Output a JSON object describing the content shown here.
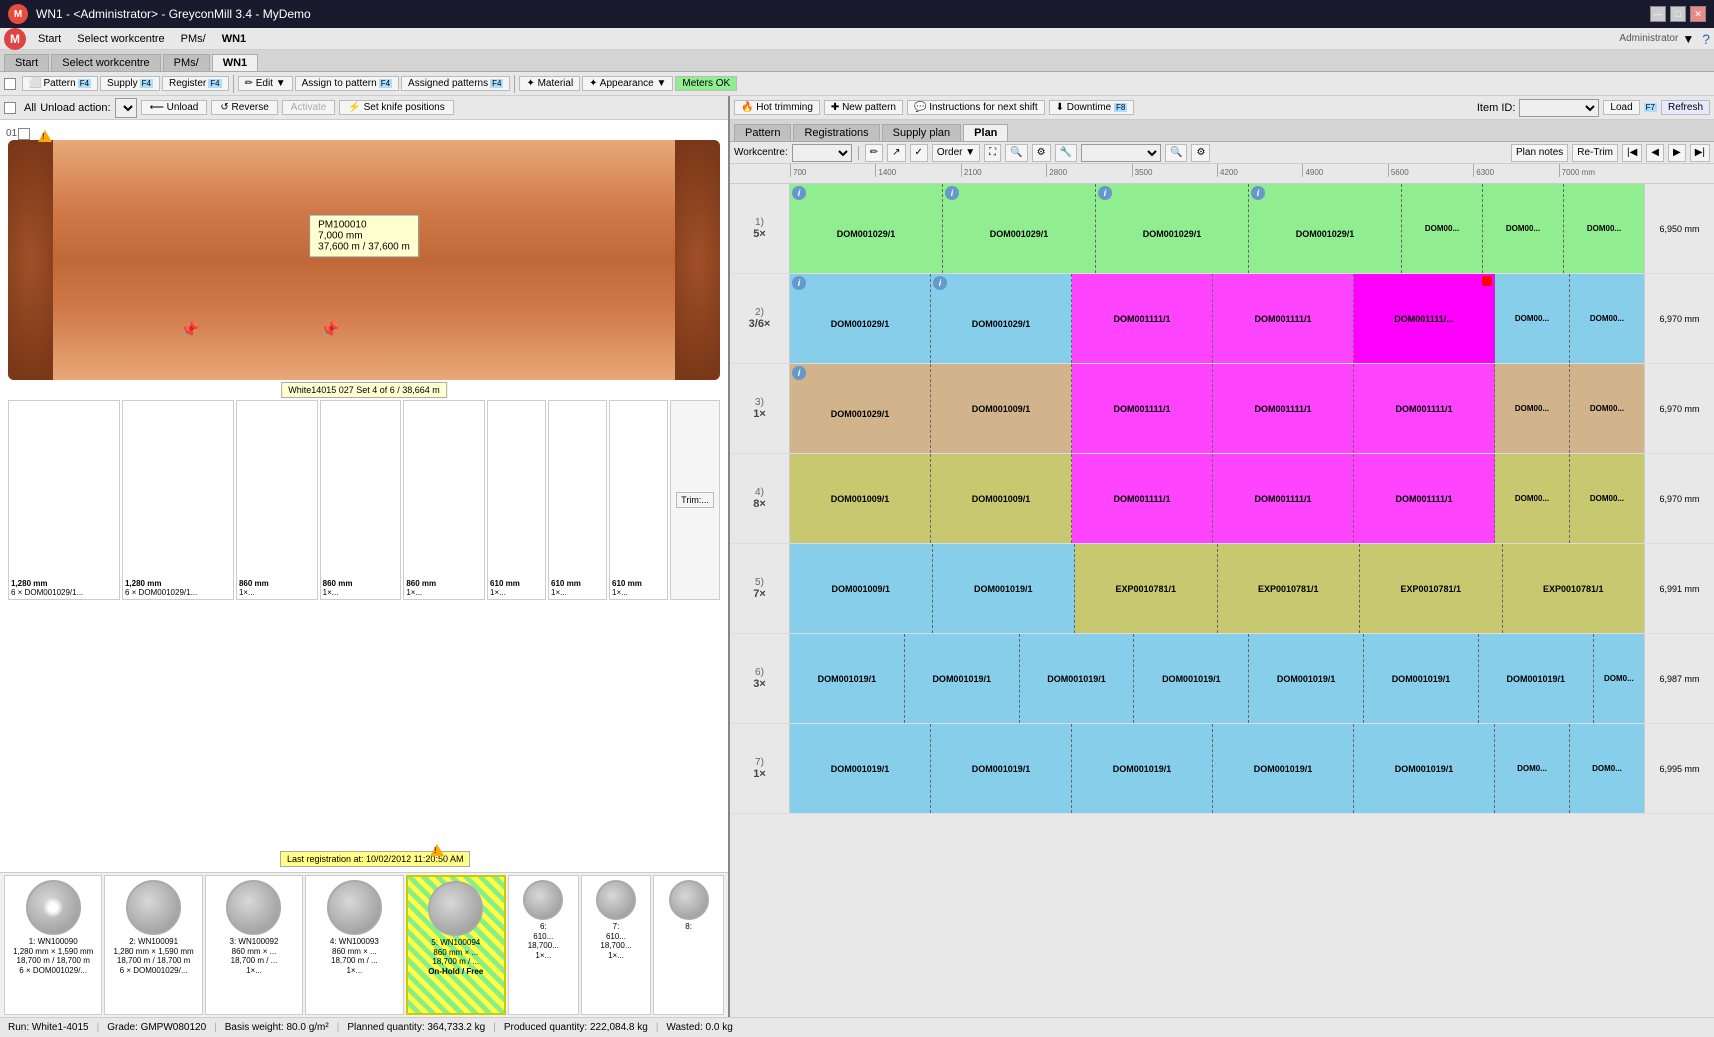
{
  "titlebar": {
    "title": "WN1 - <Administrator> - GreyconMill 3.4 - MyDemo",
    "min": "—",
    "max": "□",
    "close": "✕",
    "user": "Administrator"
  },
  "menubar": {
    "items": [
      "Start",
      "Select workcentre",
      "PMs/",
      "WN1"
    ]
  },
  "toolbar": {
    "items": [
      "⬜ Pattern",
      "Supply",
      "Register",
      "Edit ▼",
      "Assign to pattern",
      "Assigned patterns",
      "Material",
      "Appearance ▼",
      "Meters OK"
    ]
  },
  "unload": {
    "label": "All",
    "action_label": "Unload action:",
    "unload_btn": "⟵ Unload",
    "reverse_btn": "↺ Reverse",
    "activate_btn": "Activate",
    "set_knife_btn": "⚡ Set knife positions"
  },
  "roll": {
    "id": "PM100010",
    "length": "7,000 mm",
    "progress": "37,600 m / 37,600 m",
    "set_label": "White14015 027 Set 4 of 6 / 38,664 m"
  },
  "cuts": [
    {
      "width": "1,280 mm",
      "desc": "6 × DOM001029/1..."
    },
    {
      "width": "1,280 mm",
      "desc": "6 × DOM001029/1..."
    },
    {
      "width": "860 mm",
      "desc": "1×..."
    },
    {
      "width": "860 mm",
      "desc": "1×..."
    },
    {
      "width": "860 mm",
      "desc": "1×..."
    },
    {
      "width": "610 mm",
      "desc": "1×..."
    },
    {
      "width": "610 mm",
      "desc": "1×..."
    },
    {
      "width": "610 mm",
      "desc": "1×..."
    }
  ],
  "trim_btn": "Trim:...",
  "reels": [
    {
      "id": "1: WN100090",
      "spec": "1,280 mm × 1,590 mm",
      "meters": "18,700 m / 18,700 m",
      "desc": "6 × DOM001029/..."
    },
    {
      "id": "2: WN100091",
      "spec": "1,280 mm × 1,590 mm",
      "meters": "18,700 m / 18,700 m",
      "desc": "6 × DOM001029/..."
    },
    {
      "id": "3: WN100092",
      "spec": "860 mm × ...",
      "meters": "18,700 m / ...",
      "desc": "1×..."
    },
    {
      "id": "4: WN100093",
      "spec": "860 mm × ...",
      "meters": "18,700 m / ...",
      "desc": "1×..."
    },
    {
      "id": "5: WN100094",
      "spec": "860 mm × ...",
      "meters": "18,700 m / ...",
      "desc": "On-Hold / Free",
      "highlighted": true
    },
    {
      "id": "6:",
      "spec": "610...",
      "meters": "18,700...",
      "desc": "1×..."
    },
    {
      "id": "7:",
      "spec": "610...",
      "meters": "18,700...",
      "desc": "1×..."
    },
    {
      "id": "8:",
      "spec": "",
      "meters": "",
      "desc": ""
    }
  ],
  "right_toolbar": {
    "items": [
      "🔥 Hot trimming",
      "✚ New pattern",
      "💬 Instructions for next shift",
      "⬇ Downtime"
    ],
    "item_id_label": "Item ID:",
    "load_btn": "Load",
    "refresh_btn": "Refresh"
  },
  "right_tabs": [
    "Pattern",
    "Registrations",
    "Supply plan",
    "Plan"
  ],
  "active_right_tab": "Plan",
  "plan_controls": {
    "workcentre_label": "Workcentre:",
    "order_label": "Order ▼",
    "plan_notes_btn": "Plan notes",
    "retrim_btn": "Re-Trim"
  },
  "ruler": {
    "ticks": [
      "700",
      "1400",
      "2100",
      "2800",
      "3500",
      "4200",
      "4900",
      "5600",
      "6300",
      "7000 mm"
    ]
  },
  "plan_rows": [
    {
      "num": "1)",
      "mult": "5×",
      "cells": [
        "DOM001029/1",
        "DOM001029/1",
        "DOM001029/1",
        "DOM001029/1",
        "DOM00...",
        "DOM00...",
        "DOM00..."
      ],
      "color": "row-green",
      "right_label": "6,950 mm"
    },
    {
      "num": "2)",
      "mult": "3/6×",
      "cells": [
        "DOM001029/1",
        "DOM001029/1",
        "DOM001111/1",
        "DOM001111/1",
        "DOM001111/...",
        "DOM00...",
        "DOM00..."
      ],
      "color": "row-cyan",
      "right_label": "6,970 mm",
      "has_magenta": true
    },
    {
      "num": "3)",
      "mult": "1×",
      "cells": [
        "DOM001029/1",
        "DOM001009/1",
        "DOM001111/1",
        "DOM001111/1",
        "DOM001111/1",
        "DOM00...",
        "DOM00..."
      ],
      "color": "row-tan",
      "right_label": "6,970 mm",
      "has_magenta": true
    },
    {
      "num": "4)",
      "mult": "8×",
      "cells": [
        "DOM001009/1",
        "DOM001009/1",
        "DOM001111/1",
        "DOM001111/1",
        "DOM001111/1",
        "DOM00...",
        "DOM00..."
      ],
      "color": "row-olive",
      "right_label": "6,970 mm",
      "has_magenta": true
    },
    {
      "num": "5)",
      "mult": "7×",
      "cells": [
        "DOM001009/1",
        "DOM001019/1",
        "EXP0010781/1",
        "EXP0010781/1",
        "EXP0010781/1",
        "EXP0010781/1"
      ],
      "color": "row-blue-light",
      "right_label": "6,991 mm"
    },
    {
      "num": "6)",
      "mult": "3×",
      "cells": [
        "DOM001019/1",
        "DOM001019/1",
        "DOM001019/1",
        "DOM001019/1",
        "DOM001019/1",
        "DOM001019/1",
        "DOM001019/1",
        "DOM0..."
      ],
      "color": "row-cyan",
      "right_label": "6,987 mm"
    },
    {
      "num": "7)",
      "mult": "1×",
      "cells": [
        "DOM001019/1",
        "DOM001019/1",
        "DOM001019/1",
        "DOM001019/1",
        "DOM001019/1",
        "DOM0...",
        "DOM0..."
      ],
      "color": "row-cyan",
      "right_label": "6,995 mm"
    }
  ],
  "statusbar": {
    "run": "Run:  White1-4015",
    "grade": "Grade:  GMPW080120",
    "basis_weight": "Basis weight:  80.0 g/m²",
    "planned_qty": "Planned quantity:  364,733.2 kg",
    "produced_qty": "Produced quantity:  222,084.8 kg",
    "wasted": "Wasted:  0.0 kg"
  }
}
